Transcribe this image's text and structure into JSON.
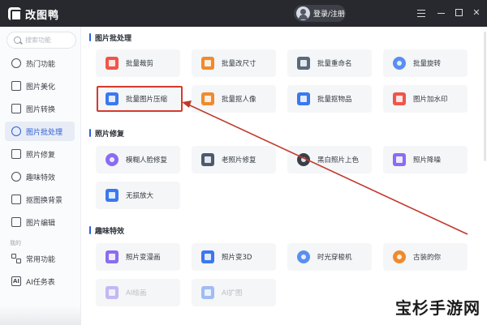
{
  "app": {
    "title": "改图鸭",
    "login_label": "登录/注册"
  },
  "window_controls": [
    "menu-icon",
    "minimize-icon",
    "maximize-icon",
    "close-icon"
  ],
  "sidebar": {
    "search_placeholder": "搜索功能",
    "items": [
      {
        "label": "热门功能",
        "icon": "fire-icon"
      },
      {
        "label": "图片美化",
        "icon": "image-icon"
      },
      {
        "label": "图片转换",
        "icon": "convert-icon"
      },
      {
        "label": "图片批处理",
        "icon": "batch-icon",
        "active": true
      },
      {
        "label": "照片修复",
        "icon": "repair-icon"
      },
      {
        "label": "趣味特效",
        "icon": "effects-icon"
      },
      {
        "label": "抠图换背景",
        "icon": "cutout-icon"
      },
      {
        "label": "图片编辑",
        "icon": "edit-icon"
      }
    ],
    "mine_section_label": "我的",
    "mine_items": [
      {
        "label": "常用功能",
        "icon": "grid-icon"
      },
      {
        "label": "AI任务表",
        "icon": "ai-icon"
      }
    ]
  },
  "main": {
    "sections": [
      {
        "title": "图片批处理",
        "tools": [
          {
            "label": "批量裁剪",
            "icon": "crop-icon",
            "color": "#f0554a"
          },
          {
            "label": "批量改尺寸",
            "icon": "resize-icon",
            "color": "#f08a2c"
          },
          {
            "label": "批量重命名",
            "icon": "rename-icon",
            "color": "#5a6a7e"
          },
          {
            "label": "批量旋转",
            "icon": "rotate-icon",
            "color": "#5a8ef0"
          },
          {
            "label": "批量图片压缩",
            "icon": "compress-icon",
            "color": "#3b78f0"
          },
          {
            "label": "批量抠人像",
            "icon": "portrait-cutout-icon",
            "color": "#f08a2c"
          },
          {
            "label": "批量抠物品",
            "icon": "object-cutout-icon",
            "color": "#3b78f0"
          },
          {
            "label": "图片加水印",
            "icon": "watermark-icon",
            "color": "#f0554a"
          }
        ]
      },
      {
        "title": "照片修复",
        "tools": [
          {
            "label": "模糊人脸修复",
            "icon": "face-repair-icon",
            "color": "#8a6cf0"
          },
          {
            "label": "老照片修复",
            "icon": "old-photo-icon",
            "color": "#4a5a70"
          },
          {
            "label": "黑白照片上色",
            "icon": "colorize-icon",
            "color": "#3a3f47"
          },
          {
            "label": "照片降噪",
            "icon": "denoise-icon",
            "color": "#8a6cf0"
          },
          {
            "label": "无损放大",
            "icon": "upscale-icon",
            "color": "#3b78f0"
          }
        ]
      },
      {
        "title": "趣味特效",
        "tools": [
          {
            "label": "照片变漫画",
            "icon": "comic-icon",
            "color": "#8a6cf0"
          },
          {
            "label": "照片变3D",
            "icon": "3d-icon",
            "color": "#3b78f0"
          },
          {
            "label": "时光穿梭机",
            "icon": "time-machine-icon",
            "color": "#5a8ef0"
          },
          {
            "label": "古装的你",
            "icon": "costume-icon",
            "color": "#f08a2c"
          },
          {
            "label": "AI绘画",
            "icon": "ai-paint-icon",
            "color": "#8a6cf0",
            "faded": true
          },
          {
            "label": "AI扩图",
            "icon": "ai-expand-icon",
            "color": "#3b78f0",
            "faded": true
          }
        ]
      }
    ]
  },
  "annotation": {
    "highlight_color": "#d63a2f",
    "target_tool": "批量图片压缩"
  },
  "watermark": "宝杉手游网"
}
